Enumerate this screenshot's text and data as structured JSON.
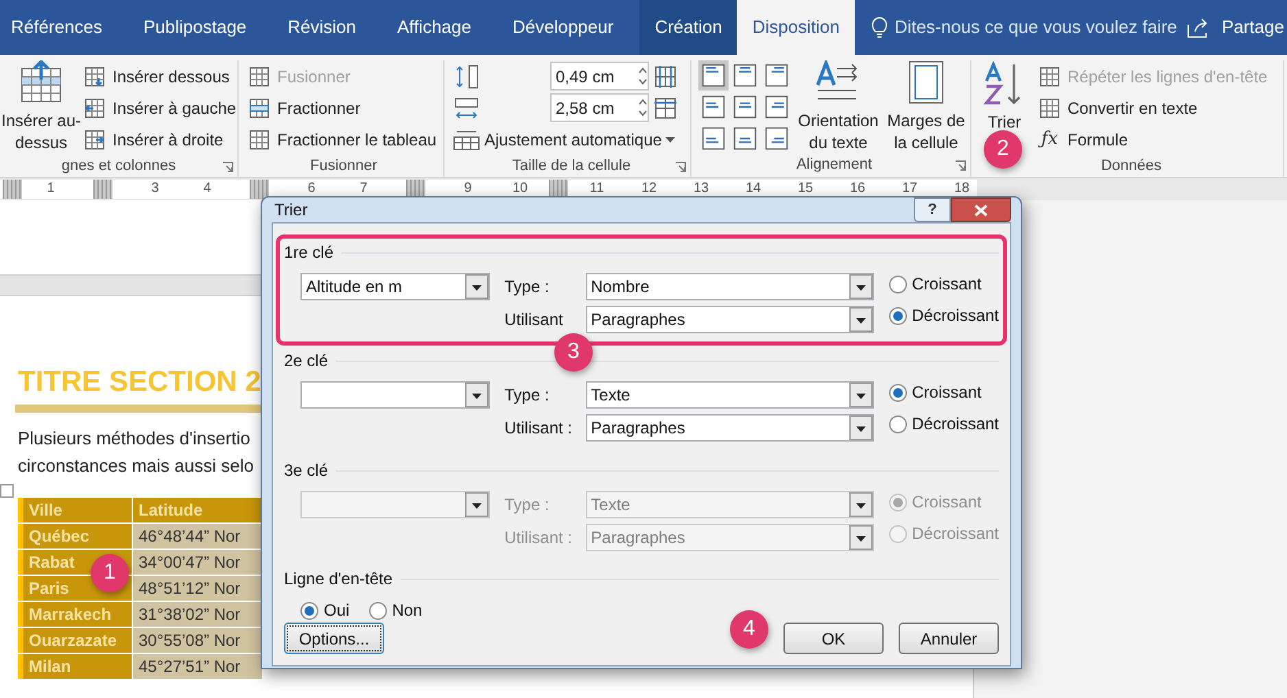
{
  "tabs": [
    {
      "label": "Références",
      "selected": false,
      "kind": "standard"
    },
    {
      "label": "Publipostage",
      "selected": false,
      "kind": "standard"
    },
    {
      "label": "Révision",
      "selected": false,
      "kind": "standard"
    },
    {
      "label": "Affichage",
      "selected": false,
      "kind": "standard"
    },
    {
      "label": "Développeur",
      "selected": false,
      "kind": "standard"
    },
    {
      "label": "Création",
      "selected": false,
      "kind": "contextual"
    },
    {
      "label": "Disposition",
      "selected": true,
      "kind": "contextual"
    }
  ],
  "tell_me": "Dites-nous ce que vous voulez faire",
  "share": "Partage",
  "ribbon": {
    "rows_columns": {
      "big": "Insérer au-dessus",
      "items": [
        "Insérer dessous",
        "Insérer à gauche",
        "Insérer à droite"
      ],
      "label": "gnes et colonnes"
    },
    "merge": {
      "items": [
        {
          "label": "Fusionner",
          "disabled": true
        },
        {
          "label": "Fractionner",
          "disabled": false
        },
        {
          "label": "Fractionner le tableau",
          "disabled": false
        }
      ],
      "label": "Fusionner"
    },
    "cell_size": {
      "height": "0,49 cm",
      "width": "2,58 cm",
      "autofit": "Ajustement automatique",
      "label": "Taille de la cellule"
    },
    "alignment": {
      "cells": [
        {
          "selected": true
        },
        {
          "selected": false
        },
        {
          "selected": false
        },
        {
          "selected": false
        },
        {
          "selected": false
        },
        {
          "selected": false
        },
        {
          "selected": false
        },
        {
          "selected": false
        },
        {
          "selected": false
        }
      ],
      "direction": "Orientation du texte",
      "margins": "Marges de la cellule",
      "label": "Alignement"
    },
    "data": {
      "sort": "Trier",
      "items": [
        {
          "label": "Répéter les lignes d'en-tête",
          "disabled": true
        },
        {
          "label": "Convertir en texte",
          "disabled": false
        },
        {
          "label": "Formule",
          "disabled": false,
          "icon": "ƒx"
        }
      ],
      "label": "Données"
    }
  },
  "ruler": [
    {
      "kind": "edge"
    },
    {
      "kind": "number",
      "text": "1"
    },
    {
      "kind": "column"
    },
    {
      "kind": "number",
      "text": "3"
    },
    {
      "kind": "number",
      "text": "4"
    },
    {
      "kind": "column"
    },
    {
      "kind": "number",
      "text": "6"
    },
    {
      "kind": "number",
      "text": "7"
    },
    {
      "kind": "column"
    },
    {
      "kind": "number",
      "text": "9"
    },
    {
      "kind": "number",
      "text": "10"
    },
    {
      "kind": "edge"
    },
    {
      "kind": "number",
      "text": "11"
    },
    {
      "kind": "number",
      "text": "12"
    },
    {
      "kind": "number",
      "text": "13"
    },
    {
      "kind": "number",
      "text": "14"
    },
    {
      "kind": "number",
      "text": "15"
    },
    {
      "kind": "number",
      "text": "16"
    },
    {
      "kind": "number",
      "text": "17"
    },
    {
      "kind": "number",
      "text": "18"
    }
  ],
  "document": {
    "heading": "TITRE SECTION 2",
    "paragraph_lines": [
      "Plusieurs méthodes d'insertio",
      "circonstances mais aussi selo"
    ],
    "table": {
      "columns": [
        "Ville",
        "Latitude"
      ],
      "rows": [
        [
          "Québec",
          "46°48’44” Nor"
        ],
        [
          "Rabat",
          "34°00’47” Nor"
        ],
        [
          "Paris",
          "48°51’12” Nor"
        ],
        [
          "Marrakech",
          "31°38’02” Nor"
        ],
        [
          "Ouarzazate",
          "30°55’08” Nor"
        ],
        [
          "Milan",
          "45°27’51” Nor"
        ]
      ]
    }
  },
  "dialog": {
    "title": "Trier",
    "keys": [
      {
        "label": "1re clé",
        "field": "Altitude en m",
        "type_label": "Type :",
        "type": "Nombre",
        "using_label": "Utilisant",
        "using": "Paragraphes",
        "disabled": false,
        "highlighted": true,
        "order": [
          {
            "label": "Croissant",
            "selected": false
          },
          {
            "label": "Décroissant",
            "selected": true
          }
        ]
      },
      {
        "label": "2e clé",
        "type_label": "Type :",
        "type": "Texte",
        "using_label": "Utilisant :",
        "using": "Paragraphes",
        "disabled": false,
        "highlighted": false,
        "order": [
          {
            "label": "Croissant",
            "selected": true
          },
          {
            "label": "Décroissant",
            "selected": false
          }
        ]
      },
      {
        "label": "3e clé",
        "type_label": "Type :",
        "type": "Texte",
        "using_label": "Utilisant :",
        "using": "Paragraphes",
        "disabled": true,
        "highlighted": false,
        "order": [
          {
            "label": "Croissant",
            "selected": true
          },
          {
            "label": "Décroissant",
            "selected": false
          }
        ]
      }
    ],
    "header_row": {
      "label": "Ligne d'en-tête",
      "options": [
        {
          "label": "Oui",
          "selected": true
        },
        {
          "label": "Non",
          "selected": false
        }
      ]
    },
    "buttons": [
      {
        "label": "Options...",
        "kind": "options"
      },
      {
        "label": "OK",
        "kind": "ok"
      },
      {
        "label": "Annuler",
        "kind": "cancel"
      }
    ],
    "help": "?"
  },
  "callouts": [
    "1",
    "2",
    "3",
    "4"
  ]
}
